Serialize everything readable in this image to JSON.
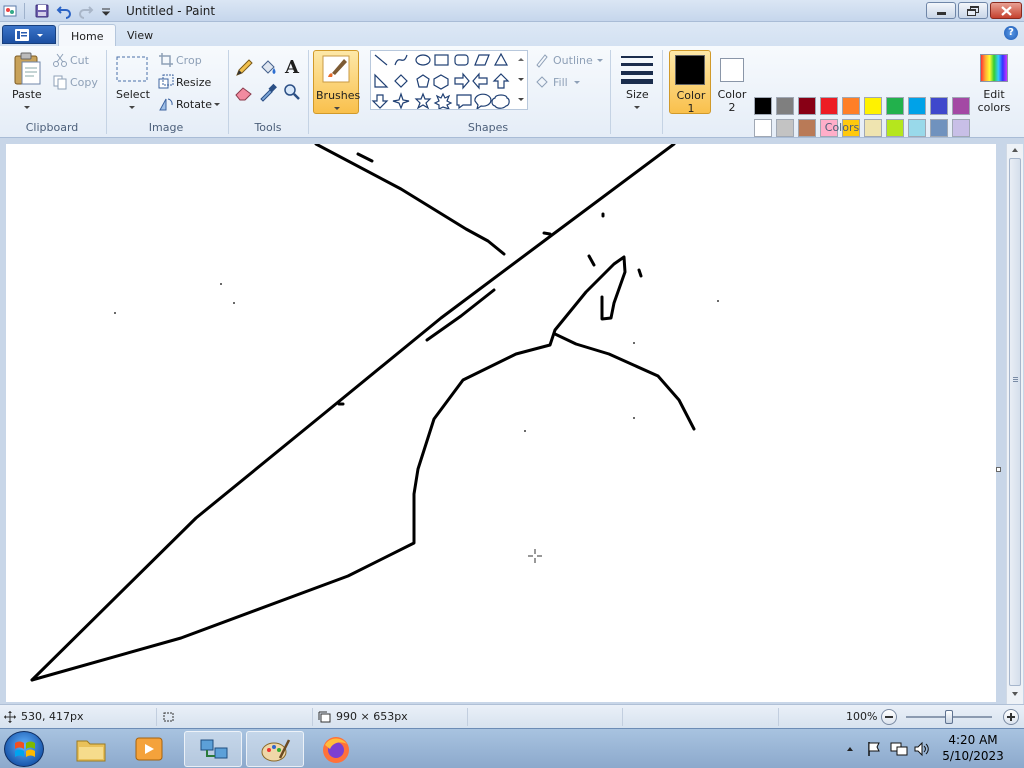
{
  "window": {
    "title": "Untitled - Paint"
  },
  "tabs": {
    "home": "Home",
    "view": "View"
  },
  "clipboard": {
    "paste": "Paste",
    "cut": "Cut",
    "copy": "Copy",
    "group": "Clipboard"
  },
  "image": {
    "select": "Select",
    "crop": "Crop",
    "resize": "Resize",
    "rotate": "Rotate",
    "group": "Image"
  },
  "tools": {
    "group": "Tools",
    "text_glyph": "A"
  },
  "brushes": {
    "label": "Brushes"
  },
  "shapes": {
    "outline": "Outline",
    "fill": "Fill",
    "group": "Shapes"
  },
  "size": {
    "label": "Size"
  },
  "colors": {
    "color1": "Color 1",
    "color2": "Color 2",
    "edit": "Edit colors",
    "group": "Colors",
    "color1_value": "#000000",
    "color2_value": "#ffffff",
    "palette_row1": [
      "#000000",
      "#7f7f7f",
      "#880015",
      "#ed1c24",
      "#ff7f27",
      "#fff200",
      "#22b14c",
      "#00a2e8",
      "#3f48cc",
      "#a349a4"
    ],
    "palette_row2": [
      "#ffffff",
      "#c3c3c3",
      "#b97a57",
      "#ffaec9",
      "#ffc90e",
      "#efe4b0",
      "#b5e61d",
      "#99d9ea",
      "#7092be",
      "#c8bfe7"
    ]
  },
  "status": {
    "cursor_position": "530, 417px",
    "canvas_size": "990 × 653px",
    "zoom": "100%"
  },
  "taskbar": {
    "time": "4:20 AM",
    "date": "5/10/2023"
  }
}
